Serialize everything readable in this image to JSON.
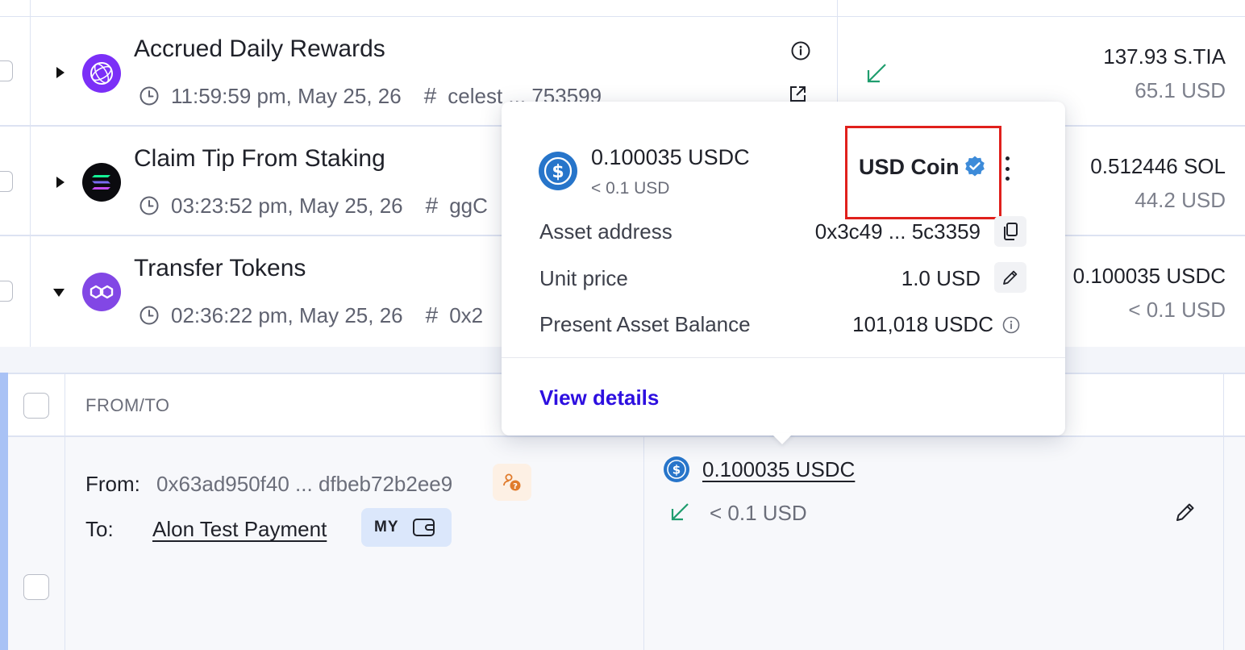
{
  "rows": [
    {
      "title": "Accrued Daily Rewards",
      "time": "11:59:59 pm, May 25, 26",
      "hash": "celest ... 753599",
      "amount": "137.93 S.TIA",
      "usd": "65.1 USD",
      "icon": "celestia-icon",
      "color": "#7b2ff7"
    },
    {
      "title": "Claim Tip From Staking",
      "time": "03:23:52 pm, May 25, 26",
      "hash": "ggC",
      "amount": "0.512446 SOL",
      "usd": "44.2 USD",
      "icon": "solana-icon",
      "color": "#0b0b0f"
    },
    {
      "title": "Transfer Tokens",
      "time": "02:36:22 pm, May 25, 26",
      "hash": "0x2",
      "amount": "0.100035 USDC",
      "usd": "< 0.1 USD",
      "icon": "polygon-icon",
      "color": "#8247e5"
    }
  ],
  "details": {
    "header_from_to": "FROM/TO",
    "from_label": "From:",
    "from_address": "0x63ad950f40 ... dfbeb72b2ee9",
    "to_label": "To:",
    "to_name": "Alon Test Payment",
    "my_badge": "MY",
    "asset_amount": "0.100035 USDC",
    "asset_usd": "< 0.1 USD"
  },
  "popover": {
    "amount": "0.100035 USDC",
    "usd": "< 0.1 USD",
    "coin_name": "USD Coin",
    "asset_address_label": "Asset address",
    "asset_address": "0x3c49 ... 5c3359",
    "unit_price_label": "Unit price",
    "unit_price": "1.0 USD",
    "balance_label": "Present Asset Balance",
    "balance": "101,018 USDC",
    "view_details": "View details"
  },
  "colors": {
    "accent_blue": "#2d0fe0",
    "usdc_blue": "#2775ca",
    "incoming_green": "#1f9d6e",
    "highlight_red": "#e0201c",
    "verified_blue": "#3d8bd9"
  }
}
